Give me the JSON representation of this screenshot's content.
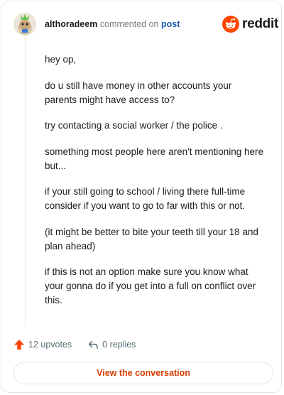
{
  "comment": {
    "username": "althoradeem",
    "action_text": "commented on",
    "post_link": "post",
    "paragraphs": [
      "hey op,",
      "do u still have money in other accounts your parents might have access to?",
      "try contacting a social worker / the police .",
      "something most people here aren't mentioning here but...",
      "if your still going to school / living there full-time consider if you want to go to far with this or not.",
      "(it might be better to bite your teeth till your 18 and plan ahead)",
      "if this is not an option make sure you know what your gonna do if you get into a full on conflict over this."
    ],
    "upvotes": "12 upvotes",
    "replies": "0 replies",
    "cta_label": "View the conversation"
  },
  "brand": {
    "name": "reddit",
    "color": "#ff4500"
  },
  "icons": {
    "upvote": "upvote-arrow-icon",
    "reply": "reply-arrow-icon",
    "logo": "reddit-snoo-icon",
    "avatar": "user-avatar"
  },
  "colors": {
    "upvote": "#ff4500",
    "link": "#1a5bab",
    "cta_text": "#d93a00",
    "muted": "#576f76"
  }
}
